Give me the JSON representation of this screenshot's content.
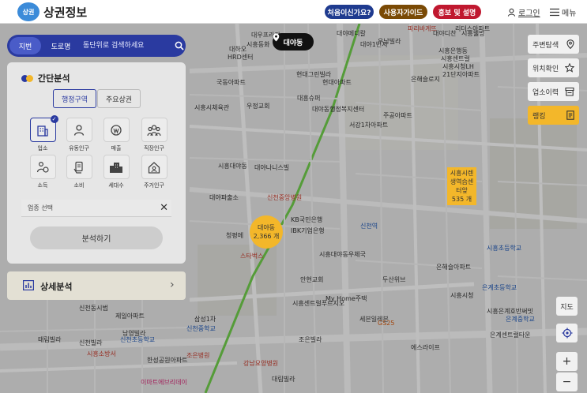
{
  "header": {
    "logo_badge": "상권",
    "title": "상권정보",
    "btn_first": "처음이신가요?",
    "btn_guide": "사용자가이드",
    "btn_promo": "홍보 및 설명",
    "login": "로그인",
    "menu": "메뉴"
  },
  "search": {
    "seg_map": "지번",
    "seg_road": "도로명",
    "placeholder": "동단위로 검색하세요"
  },
  "panel": {
    "title": "간단분석",
    "tab_admin": "행정구역",
    "tab_main": "주요상권",
    "categories": [
      "업소",
      "유동인구",
      "매출",
      "직장인구",
      "소득",
      "소비",
      "세대수",
      "주거인구"
    ],
    "select_placeholder": "업종 선택",
    "analyze_btn": "분석하기"
  },
  "detail": {
    "label": "상세분석"
  },
  "right": {
    "nearby": "주변탐색",
    "locate": "위치확인",
    "history": "업소이력",
    "rank": "랭킹",
    "map_type": "지도",
    "zoom_in": "+",
    "zoom_out": "−"
  },
  "map": {
    "location_pill": "대야동",
    "cluster_name": "대야동",
    "cluster_count": "2,366 개",
    "tag_line1": "시흥시렌",
    "tag_line2": "생역습센",
    "tag_line3": "터앞",
    "tag_count": "535 개",
    "labels": [
      {
        "t": "대우프라자",
        "c": ""
      },
      {
        "t": "시흥동화",
        "c": ""
      },
      {
        "t": "대야메디칼",
        "c": ""
      },
      {
        "t": "대야1번지",
        "c": ""
      },
      {
        "t": "대야디찬",
        "c": ""
      },
      {
        "t": "시흥웰빙",
        "c": ""
      },
      {
        "t": "파리바게뜨",
        "c": "red"
      },
      {
        "t": "리더스아파트",
        "c": ""
      },
      {
        "t": "대하오",
        "c": ""
      },
      {
        "t": "HRD센터",
        "c": ""
      },
      {
        "t": "우남빌라",
        "c": ""
      },
      {
        "t": "시흥은행동",
        "c": ""
      },
      {
        "t": "시흥센트럴",
        "c": ""
      },
      {
        "t": "국동아파트",
        "c": ""
      },
      {
        "t": "현대그린빌라",
        "c": ""
      },
      {
        "t": "현대아파트",
        "c": ""
      },
      {
        "t": "시흥시청LH",
        "c": ""
      },
      {
        "t": "21단지아파트",
        "c": ""
      },
      {
        "t": "은해슬로지",
        "c": ""
      },
      {
        "t": "시흥시체육관",
        "c": ""
      },
      {
        "t": "우정교회",
        "c": ""
      },
      {
        "t": "대흥슈퍼",
        "c": ""
      },
      {
        "t": "대야동행정복지센터",
        "c": ""
      },
      {
        "t": "주공아파트",
        "c": ""
      },
      {
        "t": "시흥대야동",
        "c": ""
      },
      {
        "t": "대야나니스빌",
        "c": ""
      },
      {
        "t": "서강1차아파트",
        "c": ""
      },
      {
        "t": "대야파출소",
        "c": ""
      },
      {
        "t": "신천중앙병원",
        "c": "red"
      },
      {
        "t": "KB국민은행",
        "c": ""
      },
      {
        "t": "IBK기업은행",
        "c": ""
      },
      {
        "t": "신천역",
        "c": "blue"
      },
      {
        "t": "청평메",
        "c": ""
      },
      {
        "t": "스타벅스",
        "c": "red"
      },
      {
        "t": "시흥대야동우체국",
        "c": ""
      },
      {
        "t": "시흥센트럴푸르지오",
        "c": ""
      },
      {
        "t": "My Home주택",
        "c": ""
      },
      {
        "t": "두산위브",
        "c": ""
      },
      {
        "t": "은해슬아파트",
        "c": ""
      },
      {
        "t": "세븐일레븐",
        "c": ""
      },
      {
        "t": "시흥초등학교",
        "c": "blue"
      },
      {
        "t": "은계중학교",
        "c": "blue"
      },
      {
        "t": "은계초등학교",
        "c": "blue"
      },
      {
        "t": "GS25",
        "c": "orange"
      },
      {
        "t": "시흥시청",
        "c": ""
      },
      {
        "t": "안현교회",
        "c": ""
      },
      {
        "t": "조은빌라",
        "c": ""
      },
      {
        "t": "에스라이프",
        "c": ""
      },
      {
        "t": "신천동시범",
        "c": ""
      },
      {
        "t": "제일아파트",
        "c": ""
      },
      {
        "t": "태림빌라",
        "c": ""
      },
      {
        "t": "시흥소방서",
        "c": "red"
      },
      {
        "t": "한성공원아파트",
        "c": ""
      },
      {
        "t": "삼성1차",
        "c": ""
      },
      {
        "t": "신천중학교",
        "c": "blue"
      },
      {
        "t": "신천초등학교",
        "c": "blue"
      },
      {
        "t": "남영빌라",
        "c": ""
      },
      {
        "t": "신천빌라",
        "c": ""
      },
      {
        "t": "은계센트럴타운",
        "c": ""
      },
      {
        "t": "시흥은계호반써밋",
        "c": ""
      },
      {
        "t": "조은병원",
        "c": "red"
      },
      {
        "t": "강남요양병원",
        "c": "red"
      },
      {
        "t": "대림빌라",
        "c": ""
      },
      {
        "t": "이마트에브리데이",
        "c": "pink"
      }
    ]
  }
}
